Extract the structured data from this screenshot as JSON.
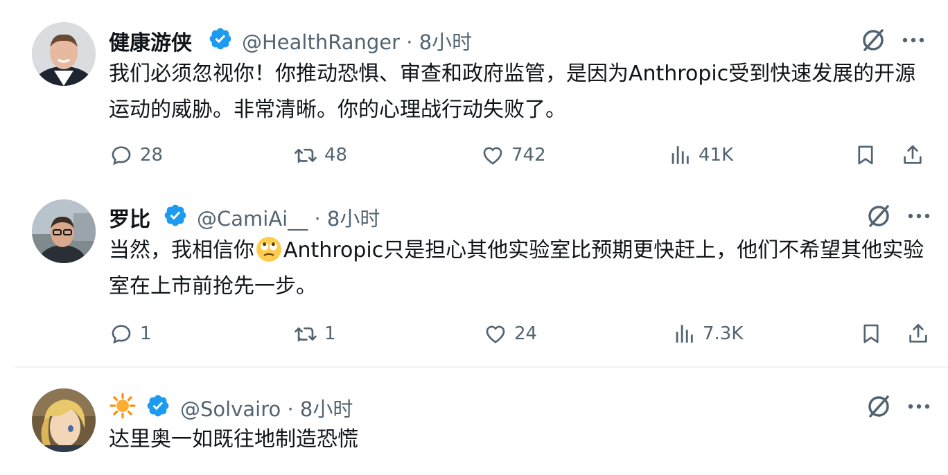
{
  "tweets": [
    {
      "name": "健康游侠",
      "handle": "@HealthRanger",
      "time": "· 8小时",
      "text": "我们必须忽视你！你推动恐惧、审查和政府监管，是因为Anthropic受到快速发展的开源运动的威胁。非常清晰。你的心理战行动失败了。",
      "replies": "28",
      "retweets": "48",
      "likes": "742",
      "views": "41K"
    },
    {
      "name": "罗比",
      "handle": "@CamiAi__",
      "time": "· 8小时",
      "text_before_emoji": "当然，我相信你",
      "emoji": "face-with-rolling-eyes",
      "text_after_emoji": "Anthropic只是担心其他实验室比预期更快赶上，他们不希望其他实验室在上市前抢先一步。",
      "replies": "1",
      "retweets": "1",
      "likes": "24",
      "views": "7.3K"
    },
    {
      "name_icon": "sun-emoji",
      "handle": "@Solvairo",
      "time": "· 8小时",
      "text": "达里奥一如既往地制造恐慌"
    }
  ],
  "colors": {
    "text": "#0f1419",
    "secondary": "#536471",
    "verified": "#1d9bf0",
    "divider": "#eff3f4"
  }
}
